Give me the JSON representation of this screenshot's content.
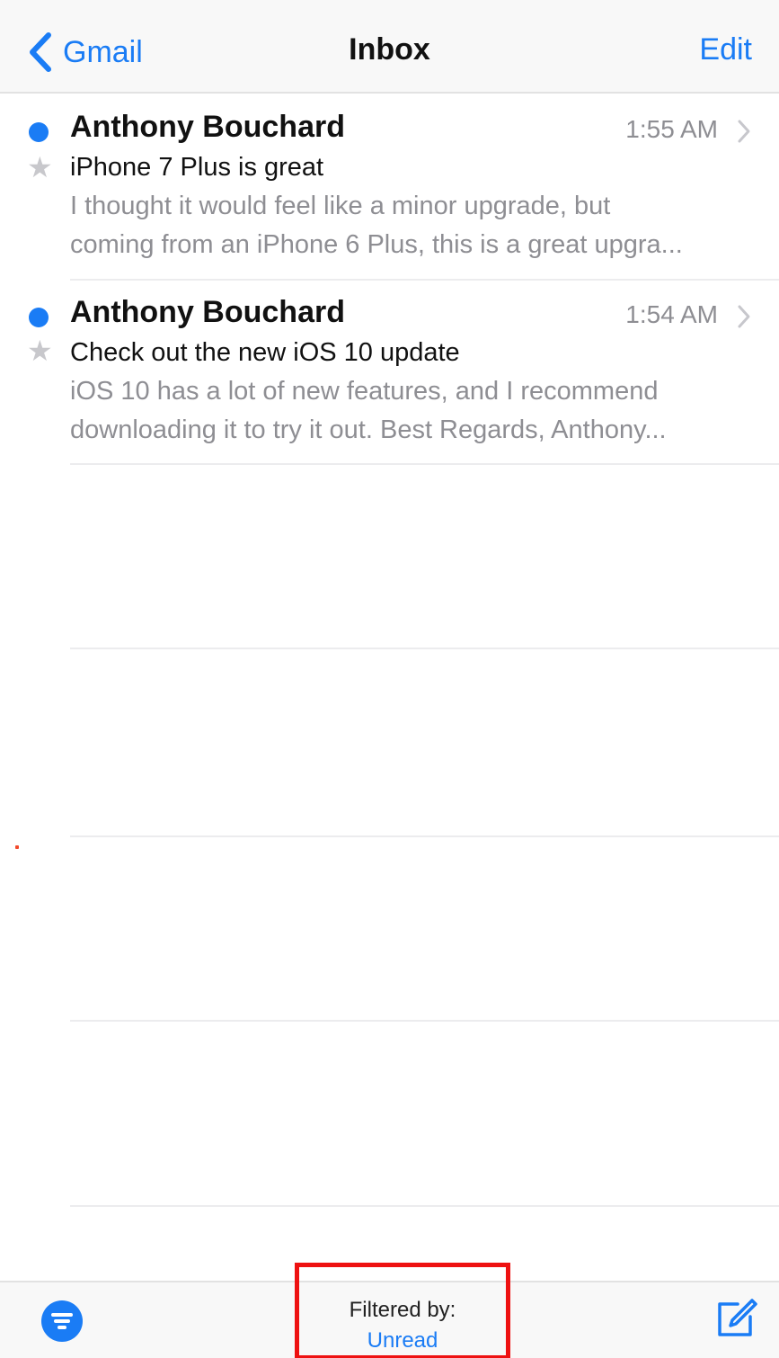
{
  "navbar": {
    "back_label": "Gmail",
    "title": "Inbox",
    "edit_label": "Edit"
  },
  "messages": [
    {
      "sender": "Anthony Bouchard",
      "time": "1:55 AM",
      "subject": "iPhone 7 Plus is great",
      "preview_line1": "I thought it would feel like a minor upgrade, but",
      "preview_line2": "coming from an iPhone 6 Plus, this is a great upgra...",
      "unread": true,
      "flagged": false
    },
    {
      "sender": "Anthony Bouchard",
      "time": "1:54 AM",
      "subject": "Check out the new iOS 10 update",
      "preview_line1": "iOS 10 has a lot of new features, and I recommend",
      "preview_line2": "downloading it to try it out. Best Regards, Anthony...",
      "unread": true,
      "flagged": false
    }
  ],
  "toolbar": {
    "filter_label": "Filtered by:",
    "filter_value": "Unread"
  },
  "icons": {
    "back": "chevron-left-icon",
    "disclosure": "chevron-right-icon",
    "star": "star-icon",
    "filter": "filter-icon",
    "compose": "compose-icon"
  },
  "colors": {
    "accent": "#1a7cf5",
    "highlight_box": "#ee1111",
    "secondary_text": "#8e8e93"
  }
}
